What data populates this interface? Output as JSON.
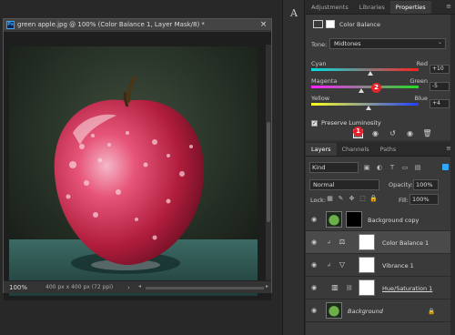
{
  "document": {
    "title": "green apple.jpg @ 100% (Color Balance 1, Layer Mask/8) *",
    "close": "×",
    "zoom": "100%",
    "doc_size": "400 px x 400 px (72 ppi)",
    "status_arrow": "›",
    "scroll_left": "◂",
    "scroll_right": "▸"
  },
  "panel_tabs": {
    "items": [
      "Adjustments",
      "Libraries",
      "Properties"
    ],
    "active": "Properties",
    "menu": "≡"
  },
  "properties": {
    "title": "Color Balance",
    "tone_label": "Tone:",
    "tone_value": "Midtones",
    "chevron": "⌄",
    "sliders": [
      {
        "left": "Cyan",
        "right": "Red",
        "value": "+10",
        "fraction": 0.55
      },
      {
        "left": "Magenta",
        "right": "Green",
        "value": "-5",
        "fraction": 0.47
      },
      {
        "left": "Yellow",
        "right": "Blue",
        "value": "+4",
        "fraction": 0.53
      }
    ],
    "preserve_label": "Preserve Luminosity",
    "preserve_checked": "✓",
    "buttons": {
      "clip": "⬚",
      "view_prev": "◉",
      "reset": "↺",
      "visibility": "◉",
      "delete": "🗑"
    }
  },
  "badges": {
    "one": "1",
    "two": "2"
  },
  "layers_tabs": {
    "items": [
      "Layers",
      "Channels",
      "Paths"
    ],
    "active": "Layers",
    "menu": "≡"
  },
  "layers_panel": {
    "kind": "Kind",
    "kind_chevron": "⌄",
    "blend_mode": "Normal",
    "opacity_label": "Opacity:",
    "opacity": "100%",
    "lock_label": "Lock:",
    "fill_label": "Fill:",
    "fill": "100%",
    "layers": [
      {
        "name": "Background copy",
        "italic": false,
        "type": "image-mask-black"
      },
      {
        "name": "Color Balance 1",
        "italic": false,
        "type": "color-balance",
        "selected": true
      },
      {
        "name": "Vibrance 1",
        "italic": false,
        "type": "vibrance"
      },
      {
        "name": "Hue/Saturation 1",
        "italic": false,
        "type": "hue-sat"
      },
      {
        "name": "Background",
        "italic": true,
        "type": "image-locked"
      }
    ]
  },
  "colors": {
    "accent": "#31a8ff",
    "badge": "#e2232e",
    "panel_bg": "#3a3a3a"
  }
}
